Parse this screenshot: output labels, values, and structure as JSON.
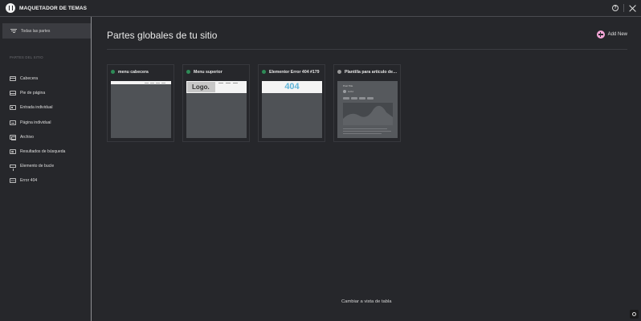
{
  "app": {
    "title": "MAQUETADOR DE TEMAS",
    "help_label": "?"
  },
  "sidebar": {
    "all_parts": "Todas las partes",
    "section_label": "PARTES DEL SITIO",
    "items": [
      {
        "label": "Cabecera",
        "icon": "header-icon"
      },
      {
        "label": "Pie de página",
        "icon": "footer-icon"
      },
      {
        "label": "Entrada individual",
        "icon": "single-post-icon"
      },
      {
        "label": "Página individual",
        "icon": "single-page-icon"
      },
      {
        "label": "Archivo",
        "icon": "archive-icon"
      },
      {
        "label": "Resultados de búsqueda",
        "icon": "search-results-icon"
      },
      {
        "label": "Elemento de bucle",
        "icon": "loop-item-icon"
      },
      {
        "label": "Error 404",
        "icon": "error-404-icon"
      }
    ]
  },
  "main": {
    "title": "Partes globales de tu sitio",
    "add_new": "Add New",
    "cards": [
      {
        "title": "menu cabecera",
        "status": "published"
      },
      {
        "title": "Menu superior",
        "status": "published",
        "thumb_text": "Logo."
      },
      {
        "title": "Elementor Error 404 #179",
        "status": "published",
        "thumb_text": "404"
      },
      {
        "title": "Plantilla para artículo del ...",
        "status": "draft",
        "thumb_text": "Post Title",
        "thumb_author": "Author"
      }
    ],
    "table_view_link": "Cambiar a vista de tabla"
  },
  "colors": {
    "accent": "#f4a6d7",
    "published": "#2e8b57",
    "draft": "#9a9a9a",
    "background": "#26272b"
  }
}
